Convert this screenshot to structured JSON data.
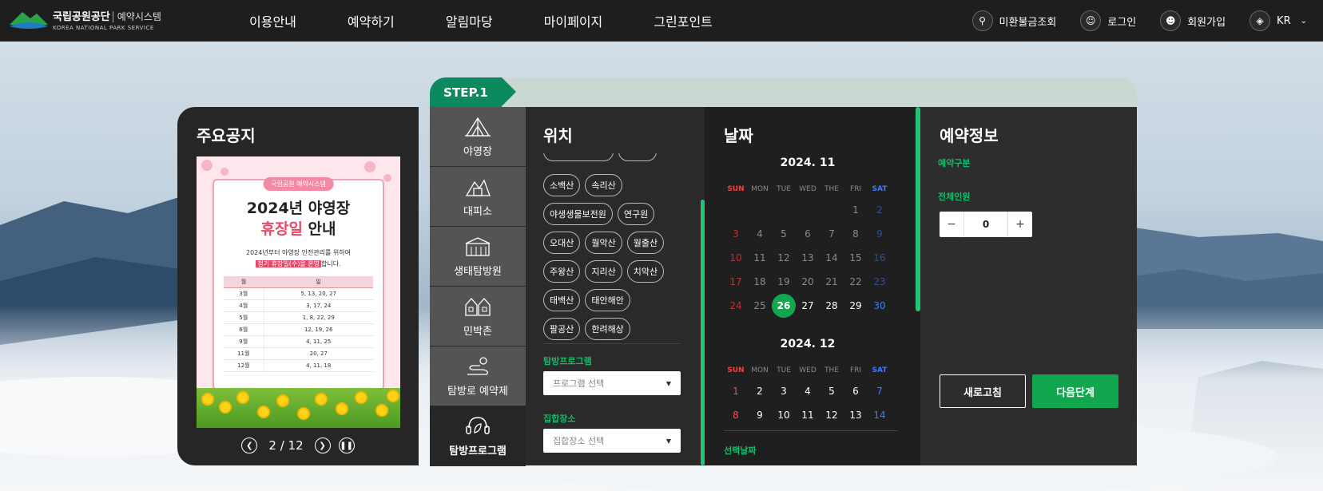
{
  "header": {
    "logo_name": "국립공원공단",
    "logo_sub": "예약시스템",
    "logo_en": "KOREA NATIONAL PARK SERVICE",
    "nav": [
      "이용안내",
      "예약하기",
      "알림마당",
      "마이페이지",
      "그린포인트"
    ],
    "util": {
      "unpaid": "미환불금조회",
      "login": "로그인",
      "signup": "회원가입",
      "lang": "KR"
    }
  },
  "notice": {
    "title": "주요공지",
    "poster": {
      "tag": "국립공원 예약시스템",
      "title_line1": "2024년 야영장",
      "title_hl": "휴장일",
      "title_rest": " 안내",
      "desc_line1": "2024년부터 야영장 안전관리를 위하여",
      "desc_hl": "정기 휴장일(수)을 운영",
      "desc_tail": "합니다.",
      "table_headers": [
        "월",
        "일"
      ],
      "table_rows": [
        [
          "3월",
          "5, 13, 20, 27"
        ],
        [
          "4월",
          "3, 17, 24"
        ],
        [
          "5월",
          "1, 8, 22, 29"
        ],
        [
          "6월",
          "12, 19, 26"
        ],
        [
          "9월",
          "4, 11, 25"
        ],
        [
          "11월",
          "20, 27"
        ],
        [
          "12월",
          "4, 11, 18"
        ]
      ]
    },
    "pager": {
      "current": "2",
      "sep": "/",
      "total": "12"
    }
  },
  "step": {
    "label": "STEP.1"
  },
  "categories": [
    {
      "label": "야영장",
      "icon": "tent-icon",
      "active": false
    },
    {
      "label": "대피소",
      "icon": "shelter-icon",
      "active": false
    },
    {
      "label": "생태탐방원",
      "icon": "eco-center-icon",
      "active": false
    },
    {
      "label": "민박촌",
      "icon": "lodging-icon",
      "active": false
    },
    {
      "label": "탐방로 예약제",
      "icon": "trail-icon",
      "active": false
    },
    {
      "label": "탐방프로그램",
      "icon": "program-icon",
      "active": true
    }
  ],
  "location": {
    "title": "위치",
    "chips": [
      "소백산",
      "속리산",
      "야생생물보전원",
      "연구원",
      "오대산",
      "월악산",
      "월출산",
      "주왕산",
      "지리산",
      "치악산",
      "태백산",
      "태안해안",
      "팔공산",
      "한려해상"
    ],
    "program_label": "탐방프로그램",
    "program_placeholder": "프로그램 선택",
    "meeting_label": "집합장소",
    "meeting_placeholder": "집합장소 선택"
  },
  "dates": {
    "title": "날짜",
    "dow": [
      "SUN",
      "MON",
      "TUE",
      "WED",
      "THE",
      "FRI",
      "SAT"
    ],
    "months": [
      {
        "title": "2024. 11",
        "weeks": [
          [
            "",
            "",
            "",
            "",
            "",
            "1",
            "2"
          ],
          [
            "3",
            "4",
            "5",
            "6",
            "7",
            "8",
            "9"
          ],
          [
            "10",
            "11",
            "12",
            "13",
            "14",
            "15",
            "16"
          ],
          [
            "17",
            "18",
            "19",
            "20",
            "21",
            "22",
            "23"
          ],
          [
            "24",
            "25",
            "26",
            "27",
            "28",
            "29",
            "30"
          ]
        ],
        "selected": "26",
        "available_from": 26
      },
      {
        "title": "2024. 12",
        "weeks": [
          [
            "1",
            "2",
            "3",
            "4",
            "5",
            "6",
            "7"
          ],
          [
            "8",
            "9",
            "10",
            "11",
            "12",
            "13",
            "14"
          ]
        ],
        "available_from": 1
      }
    ],
    "selected_label": "선택날짜"
  },
  "info": {
    "title": "예약정보",
    "type_label": "예약구분",
    "people_label": "전체인원",
    "people_value": "0",
    "minus": "−",
    "plus": "+",
    "refresh": "새로고침",
    "next": "다음단계"
  },
  "colors": {
    "accent": "#12a64e",
    "step": "#0b8a5f",
    "header_bg": "#1e1e1e"
  }
}
